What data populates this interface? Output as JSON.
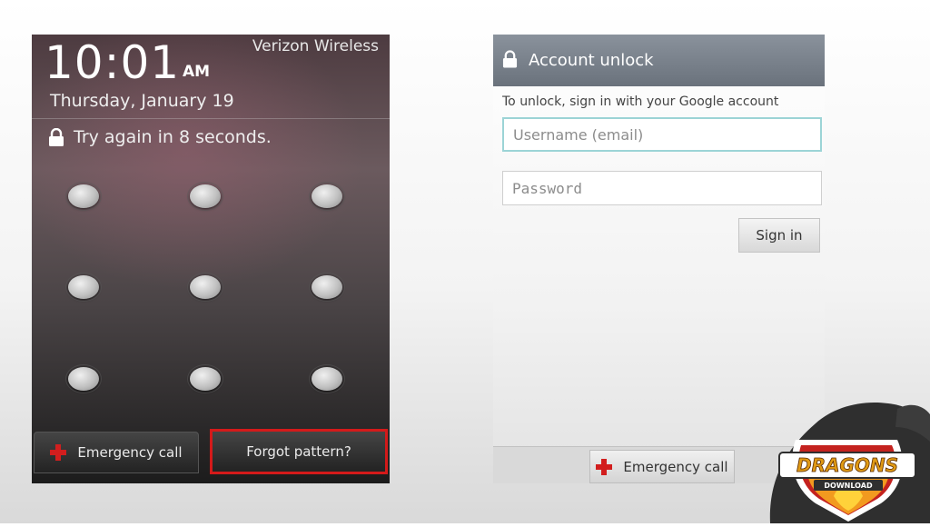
{
  "lock_screen": {
    "time": "10:01",
    "ampm": "AM",
    "carrier": "Verizon Wireless",
    "date": "Thursday, January 19",
    "status_text": "Try again in 8 seconds.",
    "emergency_call_label": "Emergency call",
    "forgot_pattern_label": "Forgot pattern?"
  },
  "account_unlock": {
    "title": "Account unlock",
    "instructions": "To unlock, sign in with your Google account",
    "username_placeholder": "Username (email)",
    "password_placeholder": "Password",
    "sign_in_label": "Sign in",
    "emergency_call_label": "Emergency call"
  },
  "watermark": {
    "brand": "DRAGONS",
    "sub": "DOWNLOAD"
  },
  "colors": {
    "highlight_border": "#d41a1a",
    "emergency_cross": "#d21e1e",
    "title_bar": "#7a828c",
    "username_focus": "#9cd4d6"
  },
  "icons": [
    "lock-icon",
    "red-cross-icon",
    "pattern-dot",
    "dragon-logo"
  ]
}
